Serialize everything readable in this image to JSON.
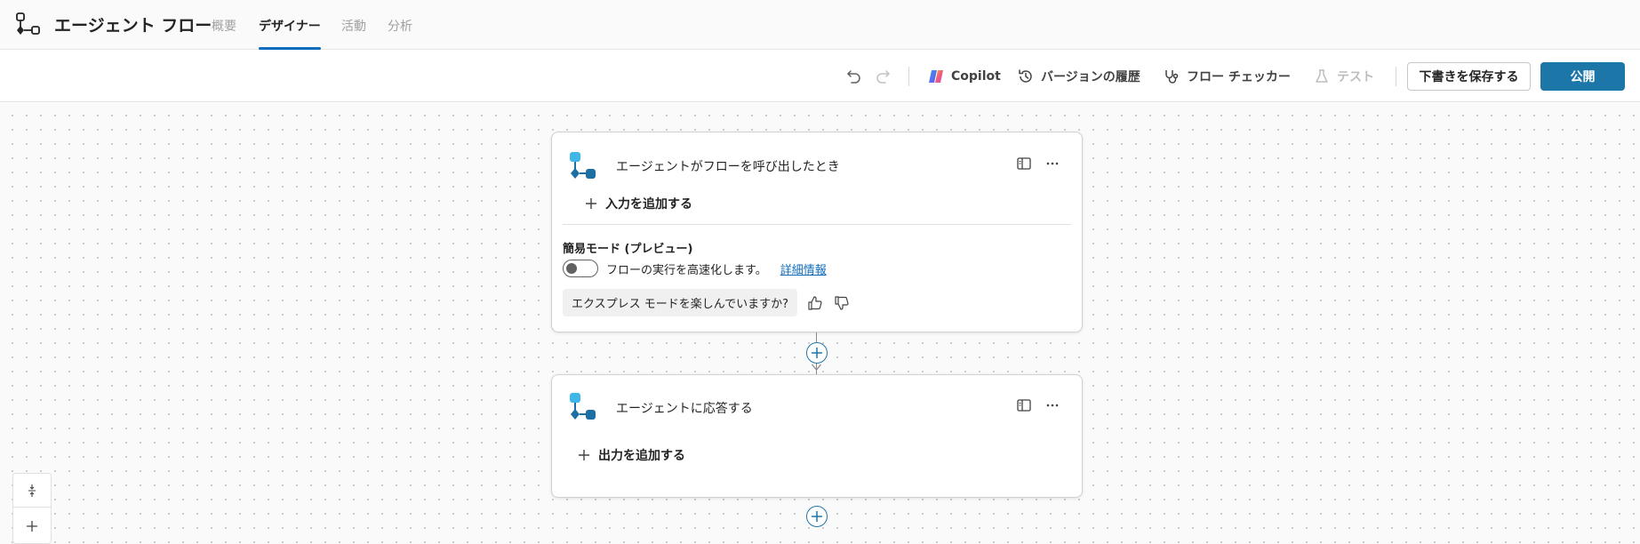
{
  "header": {
    "title": "エージェント フロー",
    "tabs": [
      {
        "label": "概要",
        "active": false
      },
      {
        "label": "デザイナー",
        "active": true
      },
      {
        "label": "活動",
        "active": false
      },
      {
        "label": "分析",
        "active": false
      }
    ]
  },
  "toolbar": {
    "copilot_label": "Copilot",
    "version_history_label": "バージョンの履歴",
    "flow_checker_label": "フロー チェッカー",
    "test_label": "テスト",
    "save_draft_label": "下書きを保存する",
    "publish_label": "公開"
  },
  "nodes": [
    {
      "title": "エージェントがフローを呼び出したとき",
      "add_label": "入力を追加する",
      "simple_mode_title": "簡易モード (プレビュー)",
      "toggle_on": false,
      "toggle_text": "フローの実行を高速化します。",
      "learn_more": "詳細情報",
      "feedback_prompt": "エクスプレス モードを楽しんでいますか?"
    },
    {
      "title": "エージェントに応答する",
      "add_label": "出力を追加する"
    }
  ],
  "colors": {
    "accent": "#0f6cbd",
    "publish_bg": "#1d76a8",
    "node_icon_light": "#3fb6e8",
    "node_icon_dark": "#1d6ea3"
  }
}
